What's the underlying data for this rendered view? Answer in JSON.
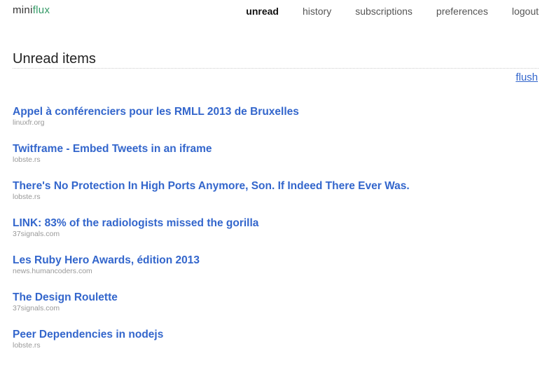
{
  "app": {
    "logo_part1": "mini",
    "logo_part2": "flux"
  },
  "nav": {
    "items": [
      {
        "label": "unread",
        "active": true
      },
      {
        "label": "history",
        "active": false
      },
      {
        "label": "subscriptions",
        "active": false
      },
      {
        "label": "preferences",
        "active": false
      },
      {
        "label": "logout",
        "active": false
      }
    ]
  },
  "page": {
    "title": "Unread items",
    "flush_label": "flush"
  },
  "items": [
    {
      "title": "Appel à conférenciers pour les RMLL 2013 de Bruxelles",
      "source": "linuxfr.org"
    },
    {
      "title": "Twitframe - Embed Tweets in an iframe",
      "source": "lobste.rs"
    },
    {
      "title": "There's No Protection In High Ports Anymore, Son. If Indeed There Ever Was.",
      "source": "lobste.rs"
    },
    {
      "title": "LINK: 83% of the radiologists missed the gorilla",
      "source": "37signals.com"
    },
    {
      "title": "Les Ruby Hero Awards, édition 2013",
      "source": "news.humancoders.com"
    },
    {
      "title": "The Design Roulette",
      "source": "37signals.com"
    },
    {
      "title": "Peer Dependencies in nodejs",
      "source": "lobste.rs"
    }
  ],
  "colors": {
    "link": "#3366cc",
    "logo_accent": "#339966",
    "source_text": "#999999"
  }
}
